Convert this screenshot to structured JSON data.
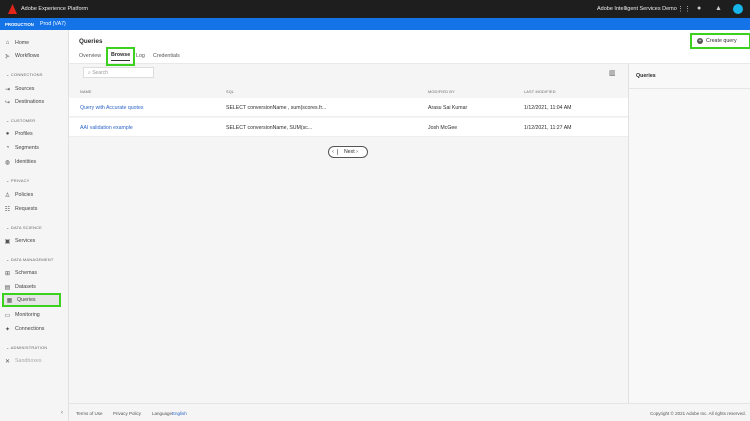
{
  "header": {
    "app_title": "Adobe Experience Platform",
    "org": "Adobe Intelligent Services Demo"
  },
  "env": {
    "label": "PRODUCTION",
    "sandbox": "Prod (VA7)"
  },
  "sidebar": {
    "home": "Home",
    "workflows": "Workflows",
    "connections": "CONNECTIONS",
    "sources": "Sources",
    "destinations": "Destinations",
    "customer": "CUSTOMER",
    "profiles": "Profiles",
    "segments": "Segments",
    "identities": "Identities",
    "privacy": "PRIVACY",
    "policies": "Policies",
    "requests": "Requests",
    "data_science": "DATA SCIENCE",
    "services": "Services",
    "data_management": "DATA MANAGEMENT",
    "schemas": "Schemas",
    "datasets": "Datasets",
    "queries": "Queries",
    "monitoring": "Monitoring",
    "connections_item": "Connections",
    "administration": "ADMINISTRATION",
    "sandboxes": "Sandboxes"
  },
  "page": {
    "title": "Queries",
    "create_label": "Create query",
    "tabs": [
      "Overview",
      "Browse",
      "Log",
      "Credentials"
    ],
    "search_placeholder": "Search"
  },
  "table": {
    "headers": [
      "NAME",
      "SQL",
      "MODIFIED BY",
      "LAST MODIFIED"
    ],
    "rows": [
      [
        "Query with Accurate quotes",
        "SELECT conversionName , sum(scores.fr...",
        "Arasu Sai Kumar",
        "1/12/2021, 11:04 AM"
      ],
      [
        "AAI validation example",
        "SELECT conversionName, SUM(sc...",
        "Josh McGee",
        "1/12/2021, 11:27 AM"
      ]
    ]
  },
  "pager": {
    "prev": "‹",
    "next": "Next ›"
  },
  "right_panel": {
    "title": "Queries"
  },
  "footer": {
    "terms": "Terms of Use",
    "privacy": "Privacy Policy",
    "language_label": "Language:",
    "language": "English",
    "copyright": "Copyright © 2021 Adobe Inc. All rights reserved."
  }
}
